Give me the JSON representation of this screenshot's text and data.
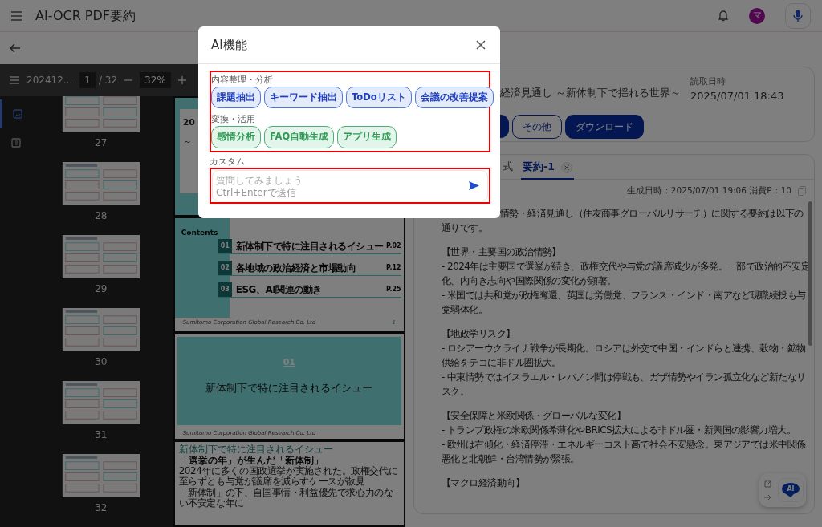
{
  "app_bar": {
    "title": "AI-OCR PDF要約",
    "avatar": "マ"
  },
  "viewer": {
    "toolbar": {
      "file_name": "202412...",
      "page": "1",
      "page_total": "/ 32",
      "zoom": "32%"
    },
    "sidebar_tabs": [
      {
        "kind": "thumbnails",
        "selected": true
      },
      {
        "kind": "outline",
        "selected": false
      }
    ],
    "thumbnails": [
      {
        "page": "27"
      },
      {
        "page": "28"
      },
      {
        "page": "29"
      },
      {
        "page": "30"
      },
      {
        "page": "31"
      },
      {
        "page": "32"
      }
    ],
    "pages": [
      {
        "kind": "cover",
        "title": "20",
        "subtitle": "～"
      },
      {
        "kind": "contents",
        "title": "Contents",
        "items": [
          {
            "number": "01",
            "label": "新体制下で特に注目されるイシュー",
            "page": "P.02"
          },
          {
            "number": "02",
            "label": "各地域の政治経済と市場動向",
            "page": "P.12"
          },
          {
            "number": "03",
            "label": "ESG、AI関連の動き",
            "page": "P.25"
          }
        ],
        "footer": "Sumitomo Corporation Global Research Co. Ltd",
        "page_number": "1"
      },
      {
        "kind": "section",
        "number": "01",
        "title": "新体制下で特に注目されるイシュー",
        "footer": "Sumitomo Corporation Global Research Co. Ltd"
      },
      {
        "kind": "body",
        "eyebrow": "新体制下で特に注目されるイシュー",
        "title": "「選挙の年」が生んだ「新体制」",
        "bullets": [
          "2024年に多くの国政選挙が実施された。政権交代に至らずとも与党が議席を減らすケースが散見",
          "「新体制」の下、自国事情・利益優先で求心力のない不安定な年に"
        ]
      }
    ]
  },
  "document": {
    "title": "経済見通し ～新体制下で揺れる世界～",
    "date_label": "読取日時",
    "date": "2025/07/01 18:43",
    "buttons": [
      {
        "kind": "filled"
      },
      {
        "kind": "outline",
        "label": "その他"
      },
      {
        "kind": "filled",
        "label": "ダウンロード"
      }
    ]
  },
  "result": {
    "tabs": [
      {
        "label": "式",
        "selected": false,
        "closable": false
      },
      {
        "label": "要約-1",
        "selected": true,
        "closable": true
      }
    ],
    "meta": "生成日時：2025/07/01 19:06 消費P：10",
    "paragraphs": [
      [
        "情勢・経済見通し（住友商事グローバルリサーチ）に関する要約は以下の",
        "通りです。"
      ],
      [
        "【世界・主要国の政治情勢】",
        "- 2024年は主要国で選挙が続き、政権交代や与党の議席減少が多発。一部で政治的不安定",
        "化、内向き志向や国際関係の変化が顕著。",
        "- 米国では共和党が政権奪還、英国は労働党、フランス・インド・南アなど現職続投も与",
        "党弱体化。"
      ],
      [
        "【地政学リスク】",
        "- ロシアーウクライナ戦争が長期化。ロシアは外交で中国・インドらと連携、穀物・鉱物",
        "供給をテコに非ドル圏拡大。",
        "- 中東情勢ではイスラエル・レバノン間は停戦も、ガザ情勢やイラン孤立化など新たなリ",
        "スク。"
      ],
      [
        "【安全保障と米欧関係・グローバルな変化】",
        "- トランプ政権の米欧関係希薄化やBRICS拡大による非ドル圏・新興国の影響力増大。",
        "- 欧州は右傾化・経済停滞・エネルギーコスト高で社会不安懸念。東アジアでは米中関係",
        "悪化と北朝鮮・台湾情勢が緊張。"
      ],
      [
        "【マクロ経済動向】"
      ]
    ],
    "fab_label": "AI"
  },
  "dialog": {
    "title": "AI機能",
    "groups": [
      {
        "label": "内容整理・分析",
        "kind": "analysis",
        "actions": [
          "課題抽出",
          "キーワード抽出",
          "ToDoリスト",
          "会議の改善提案"
        ]
      },
      {
        "label": "変換・活用",
        "kind": "transform",
        "actions": [
          "感情分析",
          "FAQ自動生成",
          "アプリ生成"
        ]
      }
    ],
    "groups_highlighted": true,
    "custom": {
      "label": "カスタム",
      "placeholder": "質問してみましょう",
      "hint": "Ctrl+Enterで送信",
      "highlighted": true
    }
  }
}
